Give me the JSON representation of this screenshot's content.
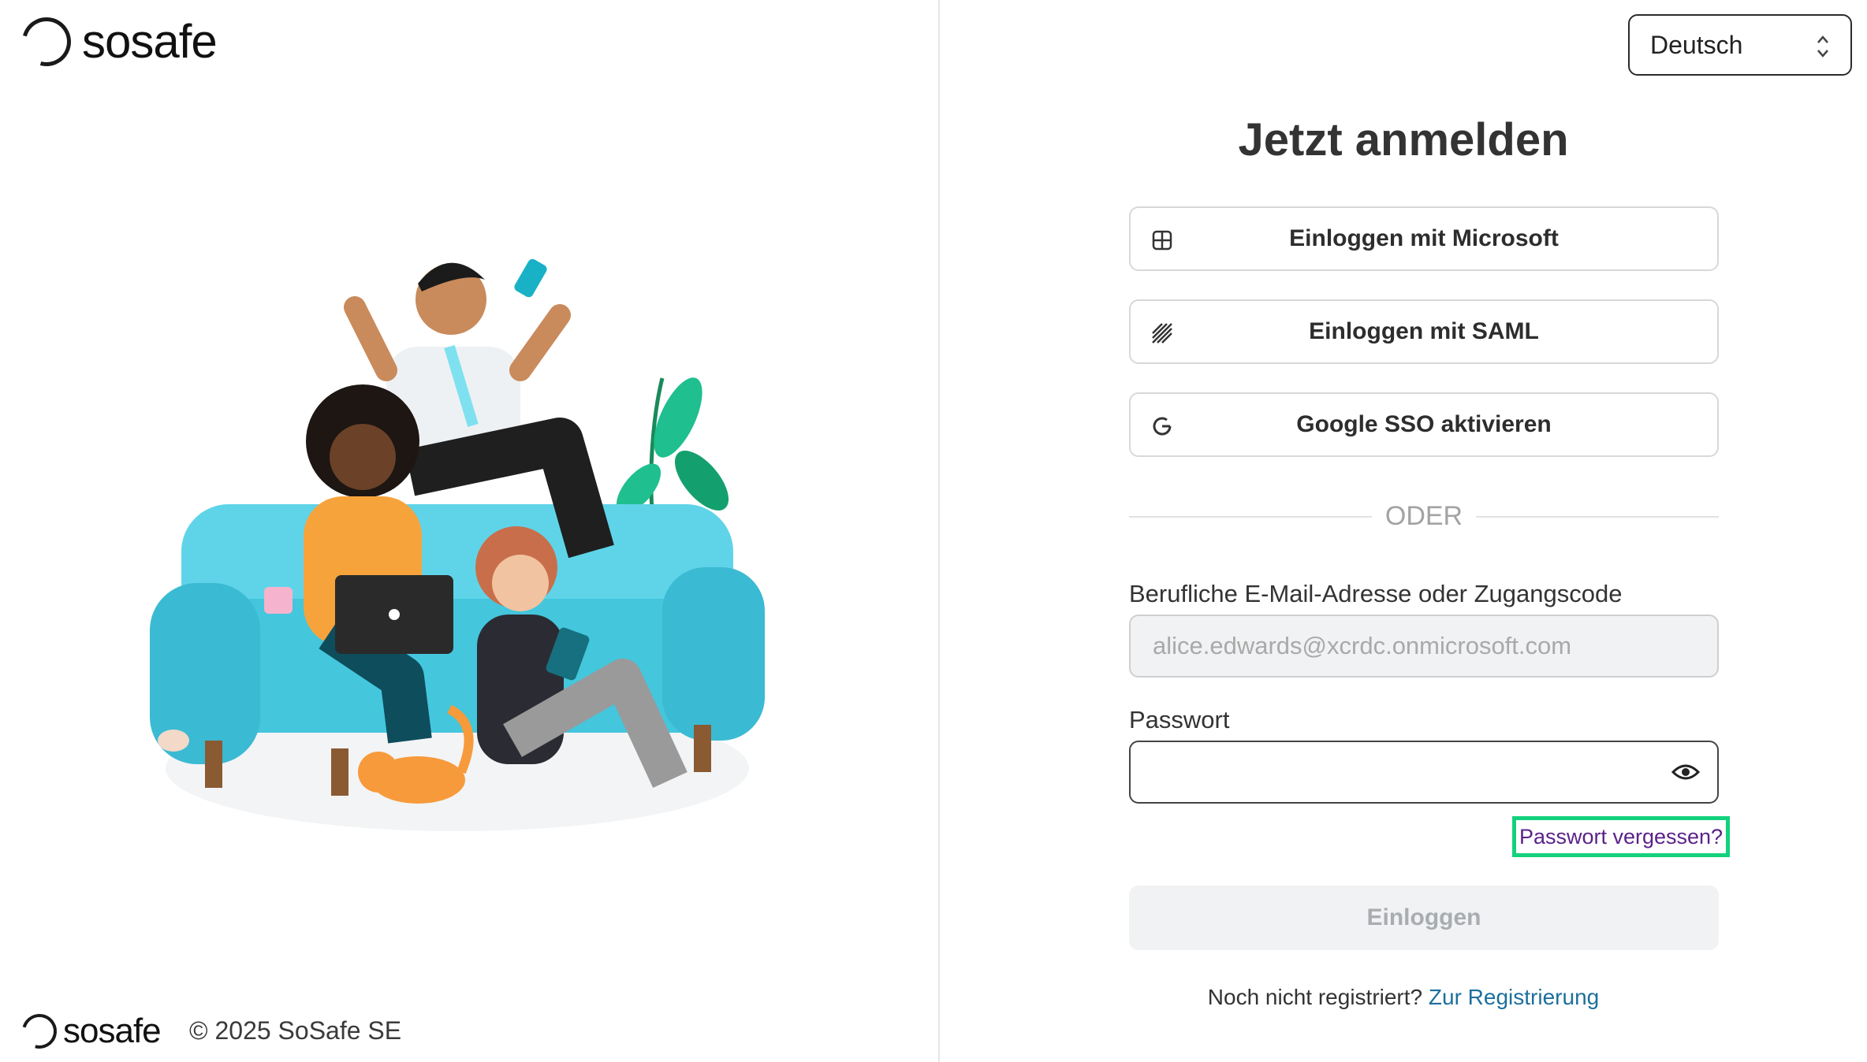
{
  "brand": {
    "name": "sosafe"
  },
  "footer": {
    "copyright": "© 2025 SoSafe SE"
  },
  "language": {
    "selected": "Deutsch"
  },
  "login": {
    "title": "Jetzt anmelden",
    "sso_buttons": [
      {
        "label": "Einloggen mit Microsoft",
        "icon": "microsoft-icon"
      },
      {
        "label": "Einloggen mit SAML",
        "icon": "saml-icon"
      },
      {
        "label": "Google SSO aktivieren",
        "icon": "google-icon"
      }
    ],
    "divider": "ODER",
    "email": {
      "label": "Berufliche E-Mail-Adresse oder Zugangscode",
      "value": "alice.edwards@xcrdc.onmicrosoft.com"
    },
    "password": {
      "label": "Passwort",
      "value": ""
    },
    "forgot_password": "Passwort vergessen?",
    "submit": "Einloggen",
    "register": {
      "prompt": "Noch nicht registriert?",
      "link": "Zur Registrierung"
    }
  },
  "colors": {
    "accent_link": "#1d6f9c",
    "forgot_link": "#5b2289",
    "highlight": "#14d17d",
    "sofa": "#4fc9df"
  }
}
